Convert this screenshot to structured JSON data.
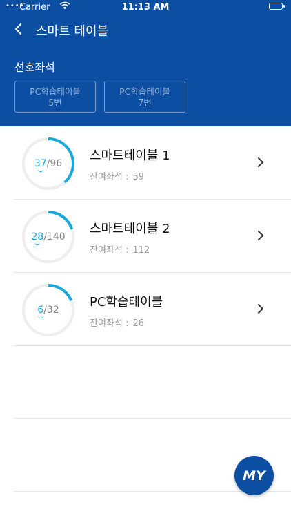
{
  "status_bar": {
    "carrier": "Carrier",
    "time": "11:13 AM"
  },
  "header": {
    "title": "스마트 테이블",
    "favorites_label": "선호좌석",
    "favorites": [
      {
        "line1": "PC학습테이블",
        "line2": "5번"
      },
      {
        "line1": "PC학습테이블",
        "line2": "7번"
      }
    ]
  },
  "tables": [
    {
      "name": "스마트테이블 1",
      "used": "37",
      "separator": "/",
      "total": "96",
      "remaining_label": "잔여좌석 :",
      "remaining": "59",
      "occupancy": 0.385
    },
    {
      "name": "스마트테이블 2",
      "used": "28",
      "separator": "/",
      "total": "140",
      "remaining_label": "잔여좌석 :",
      "remaining": "112",
      "occupancy": 0.2
    },
    {
      "name": "PC학습테이블",
      "used": "6",
      "separator": "/",
      "total": "32",
      "remaining_label": "잔여좌석 :",
      "remaining": "26",
      "occupancy": 0.1875
    }
  ],
  "fab": {
    "label": "MY"
  },
  "colors": {
    "brand": "#0c4ea2",
    "accent": "#1aa8dc",
    "ring_track": "#eeeeee"
  },
  "icons": [
    "wifi-icon",
    "battery-icon",
    "back-chevron-icon",
    "chevron-right-icon"
  ]
}
